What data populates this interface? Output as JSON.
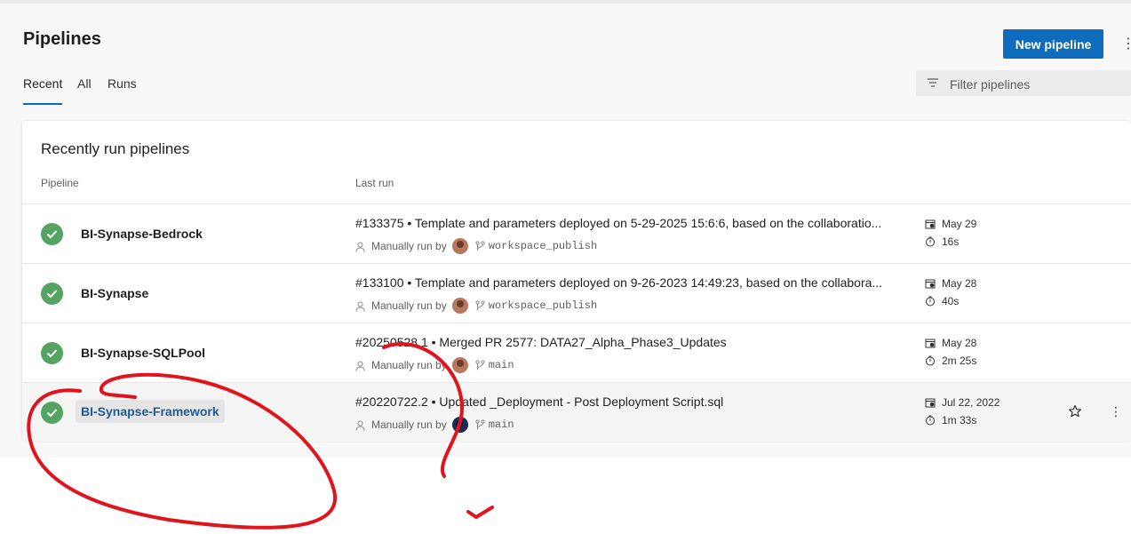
{
  "header": {
    "title": "Pipelines",
    "new_pipeline_label": "New pipeline",
    "more_label": "⋮"
  },
  "tabs": [
    {
      "label": "Recent",
      "active": true
    },
    {
      "label": "All",
      "active": false
    },
    {
      "label": "Runs",
      "active": false
    }
  ],
  "filter": {
    "placeholder": "Filter pipelines",
    "value": ""
  },
  "card": {
    "title": "Recently run pipelines",
    "columns": {
      "pipeline": "Pipeline",
      "last_run": "Last run"
    }
  },
  "rows": [
    {
      "name": "BI-Synapse-Bedrock",
      "status": "succeeded",
      "run_title": "#133375 • Template and parameters deployed on 5-29-2025 15:6:6, based on the collaboratio...",
      "trigger": "Manually run by",
      "branch": "workspace_publish",
      "date": "May 29",
      "duration": "16s"
    },
    {
      "name": "BI-Synapse",
      "status": "succeeded",
      "run_title": "#133100 • Template and parameters deployed on 9-26-2023 14:49:23, based on the collabora...",
      "trigger": "Manually run by",
      "branch": "workspace_publish",
      "date": "May 28",
      "duration": "40s"
    },
    {
      "name": "BI-Synapse-SQLPool",
      "status": "succeeded",
      "run_title": "#20250528.1 • Merged PR 2577: DATA27_Alpha_Phase3_Updates",
      "trigger": "Manually run by",
      "branch": "main",
      "date": "May 28",
      "duration": "2m 25s"
    },
    {
      "name": "BI-Synapse-Framework",
      "status": "succeeded",
      "run_title": "#20220722.2 • Updated _Deployment - Post Deployment Script.sql",
      "trigger": "Manually run by",
      "branch": "main",
      "date": "Jul 22, 2022",
      "duration": "1m 33s",
      "row_more_label": "⋮"
    }
  ],
  "colors": {
    "accent": "#0f6cbd",
    "success": "#55a362",
    "annotation": "#e0141c"
  }
}
